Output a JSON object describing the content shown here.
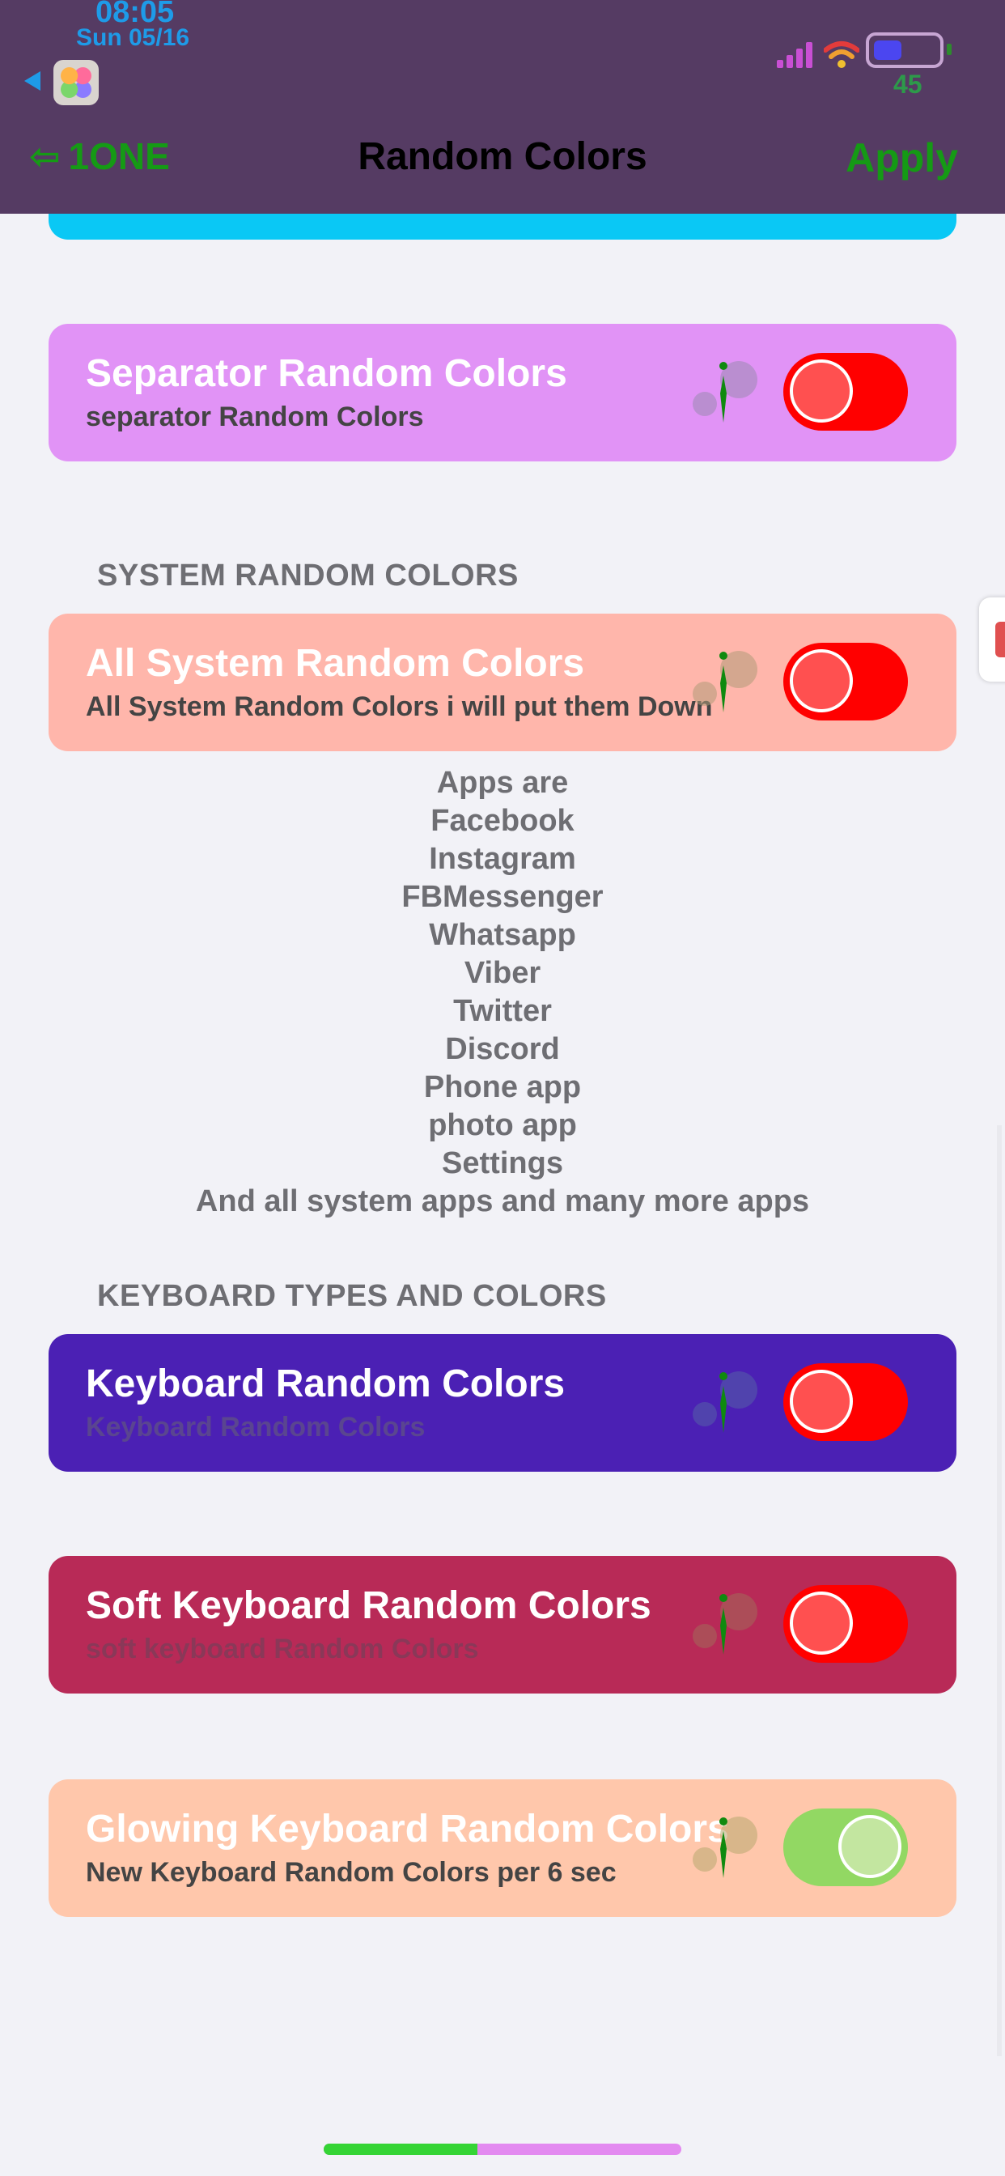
{
  "status": {
    "time": "08:05",
    "date": "Sun 05/16",
    "battery_pct": "45",
    "battery_level": 0.45
  },
  "nav": {
    "back_label": "1ONE",
    "back_icon": "arrow-left-icon",
    "title": "Random Colors",
    "apply_label": "Apply"
  },
  "cards": [
    {
      "key": "separator",
      "title": "Separator Random Colors",
      "subtitle": "separator Random Colors",
      "bg": "#e193f6",
      "title_color": "#ffffff",
      "sub_color": "#444444",
      "toggle_on": false,
      "info_tint": "#9a8ab0"
    },
    {
      "key": "all-system",
      "title": "All System Random Colors",
      "subtitle": "All System Random Colors i will put them Down",
      "bg": "#ffb6ab",
      "title_color": "#ffffff",
      "sub_color": "#444444",
      "toggle_on": false,
      "info_tint": "#b09a78"
    },
    {
      "key": "keyboard",
      "title": "Keyboard Random Colors",
      "subtitle": "Keyboard Random Colors",
      "bg": "#4b20b4",
      "title_color": "#ffffff",
      "sub_color": "#5a4590",
      "toggle_on": false,
      "info_tint": "#5660a8"
    },
    {
      "key": "soft-keyboard",
      "title": "Soft Keyboard Random Colors",
      "subtitle": "soft keyboard Random Colors",
      "bg": "#b82a57",
      "title_color": "#ffffff",
      "sub_color": "#8a3858",
      "toggle_on": false,
      "info_tint": "#a26a5a"
    },
    {
      "key": "glowing-keyboard",
      "title": "Glowing Keyboard Random Colors",
      "subtitle": "New Keyboard Random Colors per 6 sec",
      "bg": "#ffc7ab",
      "title_color": "#ffffff",
      "sub_color": "#444444",
      "toggle_on": true,
      "info_tint": "#b8a870"
    }
  ],
  "sections": {
    "system": "SYSTEM RANDOM COLORS",
    "keyboard": "KEYBOARD TYPES AND COLORS"
  },
  "apps_list": [
    "Apps are",
    "Facebook",
    "Instagram",
    "FBMessenger",
    "Whatsapp",
    "Viber",
    "Twitter",
    "Discord",
    "Phone app",
    "photo app",
    "Settings",
    "And all system apps and many more apps"
  ],
  "colors": {
    "toggle_off": "#ff0000",
    "toggle_off_knob": "#ff5050",
    "toggle_on": "#92d863",
    "toggle_on_knob": "#c3e6a0",
    "info_stem": "#0f8a0f"
  },
  "scroll": {
    "progress": 0.43
  }
}
